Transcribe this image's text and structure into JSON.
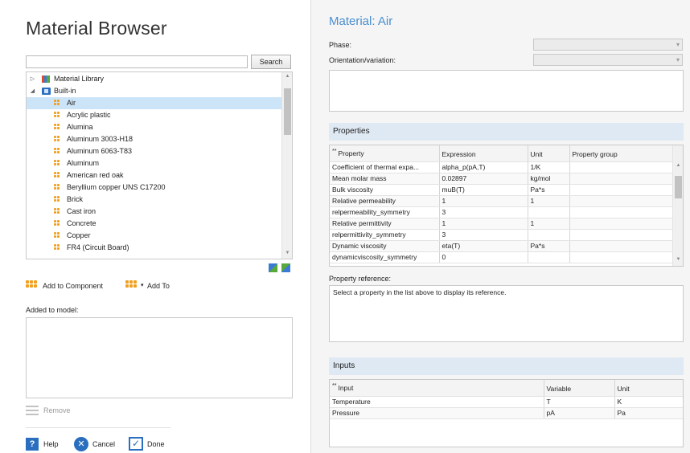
{
  "browser": {
    "title": "Material Browser",
    "search": {
      "value": "",
      "button": "Search"
    },
    "tree": {
      "items": [
        {
          "label": "Material Library",
          "toggle": "▷",
          "icon": "library-icon"
        },
        {
          "label": "Built-in",
          "toggle": "◢",
          "icon": "built-in-icon"
        },
        {
          "label": "Air",
          "icon": "material-icon",
          "selected": true
        },
        {
          "label": "Acrylic plastic",
          "icon": "material-icon"
        },
        {
          "label": "Alumina",
          "icon": "material-icon"
        },
        {
          "label": "Aluminum 3003-H18",
          "icon": "material-icon"
        },
        {
          "label": "Aluminum 6063-T83",
          "icon": "material-icon"
        },
        {
          "label": "Aluminum",
          "icon": "material-icon"
        },
        {
          "label": "American red oak",
          "icon": "material-icon"
        },
        {
          "label": "Beryllium copper UNS C17200",
          "icon": "material-icon"
        },
        {
          "label": "Brick",
          "icon": "material-icon"
        },
        {
          "label": "Cast iron",
          "icon": "material-icon"
        },
        {
          "label": "Concrete",
          "icon": "material-icon"
        },
        {
          "label": "Copper",
          "icon": "material-icon"
        },
        {
          "label": "FR4 (Circuit Board)",
          "icon": "material-icon"
        }
      ]
    },
    "add_to_component": "Add to Component",
    "add_to": "Add To",
    "add_to_arrow": "▾",
    "added_to_model_label": "Added to model:",
    "remove": "Remove",
    "help": "Help",
    "cancel": "Cancel",
    "done": "Done",
    "help_glyph": "?",
    "cancel_glyph": "✕",
    "done_glyph": "✓"
  },
  "material": {
    "title": "Material: Air",
    "phase_label": "Phase:",
    "orientation_label": "Orientation/variation:",
    "properties_header": "Properties",
    "properties_columns": [
      "Property",
      "Expression",
      "Unit",
      "Property group"
    ],
    "properties_rows": [
      [
        "Coefficient of thermal expa...",
        "alpha_p(pA,T)",
        "1/K",
        ""
      ],
      [
        "Mean molar mass",
        "0.02897",
        "kg/mol",
        ""
      ],
      [
        "Bulk viscosity",
        "muB(T)",
        "Pa*s",
        ""
      ],
      [
        "Relative permeability",
        "1",
        "1",
        ""
      ],
      [
        "relpermeability_symmetry",
        "3",
        "",
        ""
      ],
      [
        "Relative permittivity",
        "1",
        "1",
        ""
      ],
      [
        "relpermittivity_symmetry",
        "3",
        "",
        ""
      ],
      [
        "Dynamic viscosity",
        "eta(T)",
        "Pa*s",
        ""
      ],
      [
        "dynamicviscosity_symmetry",
        "0",
        "",
        ""
      ]
    ],
    "property_reference_label": "Property reference:",
    "property_reference_text": "Select a property in the list above to display its reference.",
    "inputs_header": "Inputs",
    "inputs_columns": [
      "Input",
      "Variable",
      "Unit"
    ],
    "inputs_rows": [
      [
        "Temperature",
        "T",
        "K"
      ],
      [
        "Pressure",
        "pA",
        "Pa"
      ]
    ],
    "header_mark": "**"
  },
  "colors": {
    "accent": "#4a8fcf",
    "selection": "#cce4f7",
    "section": "#dfe9f4"
  }
}
